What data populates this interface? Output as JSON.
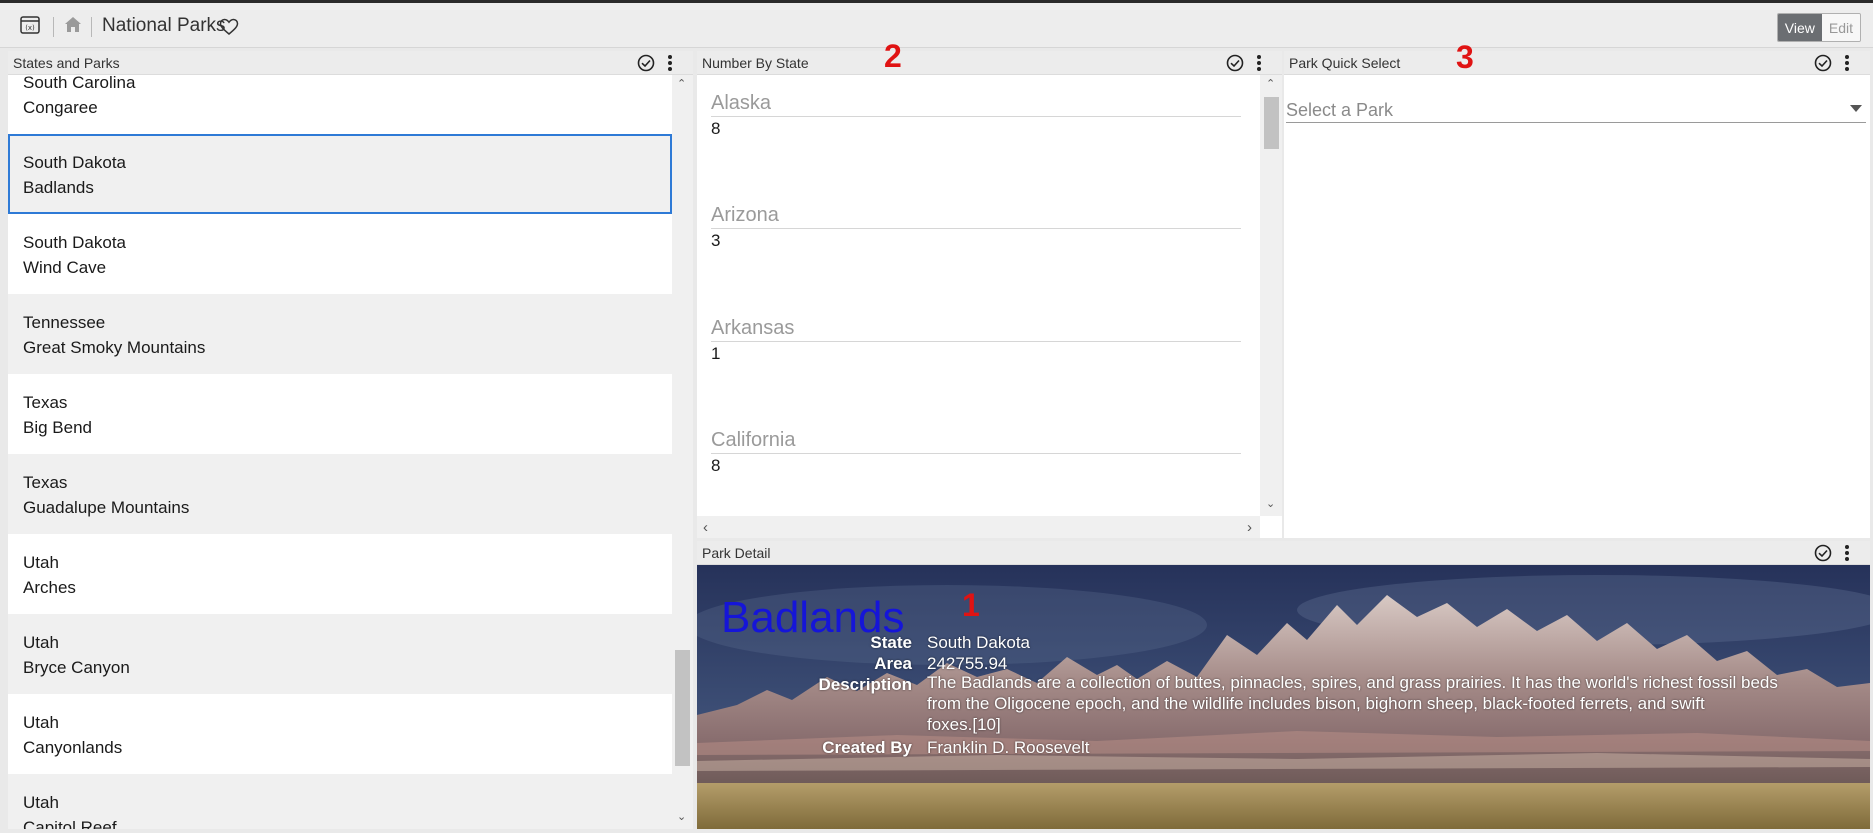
{
  "app": {
    "title": "National Parks",
    "mode": {
      "view": "View",
      "edit": "Edit"
    }
  },
  "icons": {
    "app": "app-window-icon",
    "home": "home-icon",
    "favorite": "heart-icon",
    "check": "check-circle-icon",
    "more": "more-vertical-icon"
  },
  "panels": {
    "states_and_parks": {
      "title": "States and Parks",
      "items": [
        {
          "state": "South Carolina",
          "park": "Congaree"
        },
        {
          "state": "South Dakota",
          "park": "Badlands",
          "selected": true
        },
        {
          "state": "South Dakota",
          "park": "Wind Cave"
        },
        {
          "state": "Tennessee",
          "park": "Great Smoky Mountains"
        },
        {
          "state": "Texas",
          "park": "Big Bend"
        },
        {
          "state": "Texas",
          "park": "Guadalupe Mountains"
        },
        {
          "state": "Utah",
          "park": "Arches"
        },
        {
          "state": "Utah",
          "park": "Bryce Canyon"
        },
        {
          "state": "Utah",
          "park": "Canyonlands"
        },
        {
          "state": "Utah",
          "park": "Capitol Reef"
        }
      ]
    },
    "number_by_state": {
      "title": "Number By State",
      "marker": "2",
      "stats": [
        {
          "label": "Alaska",
          "value": "8"
        },
        {
          "label": "Arizona",
          "value": "3"
        },
        {
          "label": "Arkansas",
          "value": "1"
        },
        {
          "label": "California",
          "value": "8"
        }
      ]
    },
    "park_quick_select": {
      "title": "Park Quick Select",
      "marker": "3",
      "placeholder": "Select a Park"
    },
    "park_detail": {
      "title": "Park Detail",
      "marker": "1",
      "name": "Badlands",
      "labels": {
        "state": "State",
        "area": "Area",
        "description": "Description",
        "created_by": "Created By"
      },
      "state": "South Dakota",
      "area": "242755.94",
      "description_lines": [
        "The Badlands are a collection of buttes, pinnacles, spires, and grass prairies. It has the world's richest fossil beds",
        "from the Oligocene epoch, and the wildlife includes bison, bighorn sheep, black-footed ferrets, and swift",
        "foxes.[10]"
      ],
      "created_by": "Franklin D. Roosevelt"
    }
  },
  "colors": {
    "accent": "#2e7ad6",
    "marker": "#e01313",
    "park_name": "#1515d8"
  }
}
